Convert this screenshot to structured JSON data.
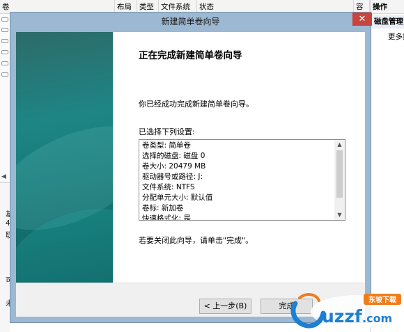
{
  "background": {
    "columns": [
      "卷",
      "布局",
      "类型",
      "文件系统",
      "状态",
      "容"
    ],
    "actions_header": "操作",
    "actions_section": "磁盘管理",
    "actions_more": "更多操",
    "left_fragments": [
      "基",
      "4",
      "联",
      "可",
      "未"
    ]
  },
  "wizard": {
    "title": "新建简单卷向导",
    "heading": "正在完成新建简单卷向导",
    "success_text": "你已经成功完成新建简单卷向导。",
    "settings_label": "已选择下列设置:",
    "settings": [
      "卷类型: 简单卷",
      "选择的磁盘: 磁盘 0",
      "卷大小: 20479 MB",
      "驱动器号或路径: J:",
      "文件系统: NTFS",
      "分配单元大小: 默认值",
      "卷标: 新加卷",
      "快速格式化: 是"
    ],
    "close_note": "若要关闭此向导，请单击\"完成\"。",
    "buttons": {
      "back": "< 上一步(B)",
      "finish": "完成"
    },
    "close_glyph": "✕"
  },
  "watermark": {
    "brand": "uzzf",
    "domain": ".com",
    "tag": "东坡下载"
  },
  "colors": {
    "banner_teal": "#1e8585",
    "frame": "#9db8d2",
    "close_red": "#c7453c",
    "watermark_blue": "#1d7fd0",
    "watermark_orange": "#f07d1a"
  }
}
